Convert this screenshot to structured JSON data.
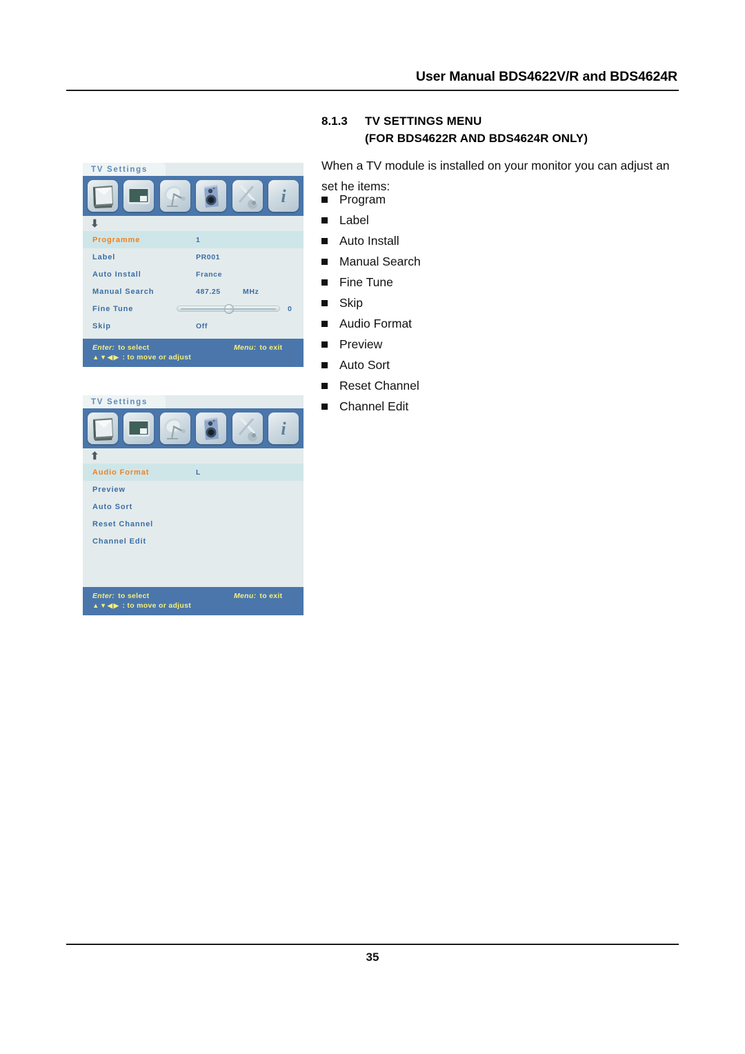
{
  "header": {
    "title": "User Manual BDS4622V/R and BDS4624R"
  },
  "section": {
    "number": "8.1.3",
    "title": "TV SETTINGS MENU",
    "subtitle": "(FOR BDS4622R AND BDS4624R ONLY)"
  },
  "body": {
    "intro": "When a TV module is installed on your monitor you can adjust an set he items:",
    "bullets": [
      {
        "label": "Program"
      },
      {
        "label": "Label"
      },
      {
        "label": "Auto Install"
      },
      {
        "label": "Manual Search"
      },
      {
        "label": "Fine Tune"
      },
      {
        "label": "Skip"
      },
      {
        "label": "Audio Format"
      },
      {
        "label": "Preview"
      },
      {
        "label": "Auto Sort"
      },
      {
        "label": "Reset Channel"
      },
      {
        "label": "Channel Edit"
      }
    ]
  },
  "osd_common": {
    "tab_label": "TV Settings",
    "icons": [
      {
        "name": "tv-monitor-icon"
      },
      {
        "name": "picture-in-picture-icon"
      },
      {
        "name": "satellite-dish-icon"
      },
      {
        "name": "speaker-icon"
      },
      {
        "name": "tools-wrench-icon"
      },
      {
        "name": "info-icon",
        "glyph": "i"
      }
    ],
    "footer": {
      "enter_key": "Enter:",
      "enter_action": "to select",
      "menu_key": "Menu:",
      "menu_action": "to exit",
      "dpad_glyphs": "▲▼◀▶",
      "dpad_action": ": to move or adjust"
    },
    "colors": {
      "panel_bg": "#e4ebec",
      "bar_blue": "#4a76ab",
      "selected_row_bg": "#cfe6e9",
      "label_blue": "#3a6ea5",
      "selected_label_orange": "#f08020",
      "footer_text_yellow": "#f5f07a"
    }
  },
  "osd_1": {
    "scroll_indicator": "↓",
    "rows": [
      {
        "label": "Programme",
        "value": "1",
        "unit": "",
        "selected": true,
        "slider": false
      },
      {
        "label": "Label",
        "value": "PR001",
        "unit": "",
        "selected": false,
        "slider": false
      },
      {
        "label": "Auto Install",
        "value": "France",
        "unit": "",
        "selected": false,
        "slider": false
      },
      {
        "label": "Manual Search",
        "value": "487.25",
        "unit": "MHz",
        "selected": false,
        "slider": false
      },
      {
        "label": "Fine Tune",
        "value": "",
        "unit": "",
        "selected": false,
        "slider": true,
        "slider_value": "0"
      },
      {
        "label": "Skip",
        "value": "Off",
        "unit": "",
        "selected": false,
        "slider": false
      }
    ]
  },
  "osd_2": {
    "scroll_indicator": "↑",
    "rows": [
      {
        "label": "Audio Format",
        "value": "L",
        "unit": "",
        "selected": true,
        "slider": false
      },
      {
        "label": "Preview",
        "value": "",
        "unit": "",
        "selected": false,
        "slider": false
      },
      {
        "label": "Auto Sort",
        "value": "",
        "unit": "",
        "selected": false,
        "slider": false
      },
      {
        "label": "Reset Channel",
        "value": "",
        "unit": "",
        "selected": false,
        "slider": false
      },
      {
        "label": "Channel Edit",
        "value": "",
        "unit": "",
        "selected": false,
        "slider": false
      }
    ]
  },
  "footer": {
    "page_number": "35"
  }
}
